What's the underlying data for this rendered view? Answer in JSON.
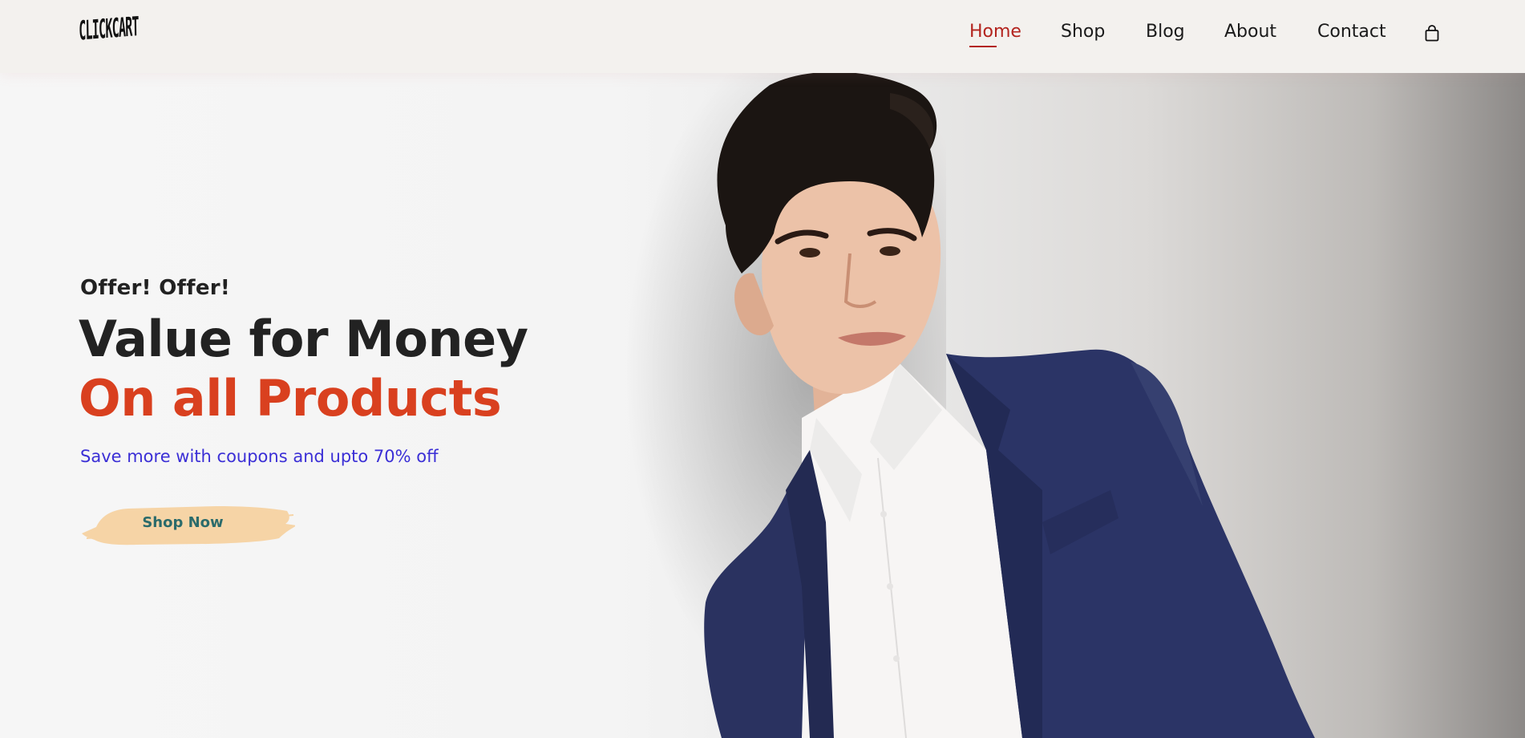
{
  "header": {
    "logo_text": "CLICKCART",
    "nav": [
      {
        "label": "Home",
        "active": true
      },
      {
        "label": "Shop",
        "active": false
      },
      {
        "label": "Blog",
        "active": false
      },
      {
        "label": "About",
        "active": false
      },
      {
        "label": "Contact",
        "active": false
      }
    ],
    "cart_icon": "shopping-bag-icon"
  },
  "hero": {
    "eyebrow": "Offer! Offer!",
    "headline_line1": "Value for Money",
    "headline_line2": "On all Products",
    "subtitle": "Save more with coupons and upto 70% off",
    "cta_label": "Shop Now"
  },
  "colors": {
    "accent_red": "#d9401f",
    "nav_active": "#b3241e",
    "subtitle_blue": "#3b2fd6",
    "cta_brush": "#f6d4a6",
    "cta_text": "#2b6b6b",
    "jacket_navy": "#27305a"
  }
}
